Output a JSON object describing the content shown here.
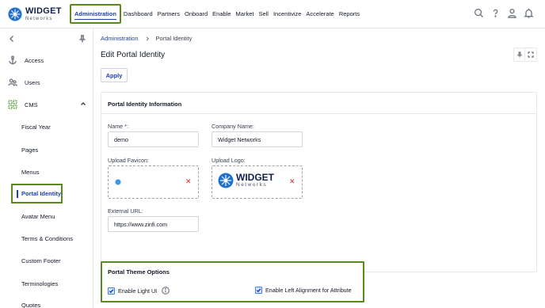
{
  "brand": {
    "title": "WIDGET",
    "subtitle": "Networks"
  },
  "nav": {
    "items": [
      "Administration",
      "Dashboard",
      "Partners",
      "Onboard",
      "Enable",
      "Market",
      "Sell",
      "Incentivize",
      "Accelerate",
      "Reports"
    ],
    "active": "Administration"
  },
  "top_icons": [
    "search-icon",
    "help-icon",
    "user-icon",
    "bell-icon"
  ],
  "sidebar": {
    "items": [
      {
        "label": "Access",
        "icon": "anchor-icon"
      },
      {
        "label": "Users",
        "icon": "users-icon"
      },
      {
        "label": "CMS",
        "icon": "cms-icon"
      }
    ],
    "cms_subitems": [
      "Fiscal Year",
      "Pages",
      "Menus",
      "Portal Identity",
      "Avatar Menu",
      "Terms & Conditions",
      "Custom Footer",
      "Terminologies",
      "Quotes"
    ],
    "active_subitem": "Portal Identity"
  },
  "breadcrumb": {
    "parent": "Administration",
    "current": "Portal Identity"
  },
  "page": {
    "title": "Edit Portal Identity",
    "apply_label": "Apply"
  },
  "identity": {
    "section_title": "Portal Identity Information",
    "name_label": "Name *:",
    "name_value": "demo",
    "company_label": "Company Name:",
    "company_value": "Widget Networks",
    "favicon_label": "Upload Favicon:",
    "logo_label": "Upload Logo:",
    "url_label": "External URL:",
    "url_value": "https://www.zinfi.com",
    "remove_symbol": "✕"
  },
  "theme": {
    "section_title": "Portal Theme Options",
    "light_ui_label": "Enable Light UI",
    "light_ui_checked": true,
    "left_align_label": "Enable Left Alignment for Attribute",
    "left_align_checked": true
  },
  "colors": {
    "accent": "#1e40af",
    "highlight_border": "#5a8a1f",
    "remove": "#dc2626"
  }
}
